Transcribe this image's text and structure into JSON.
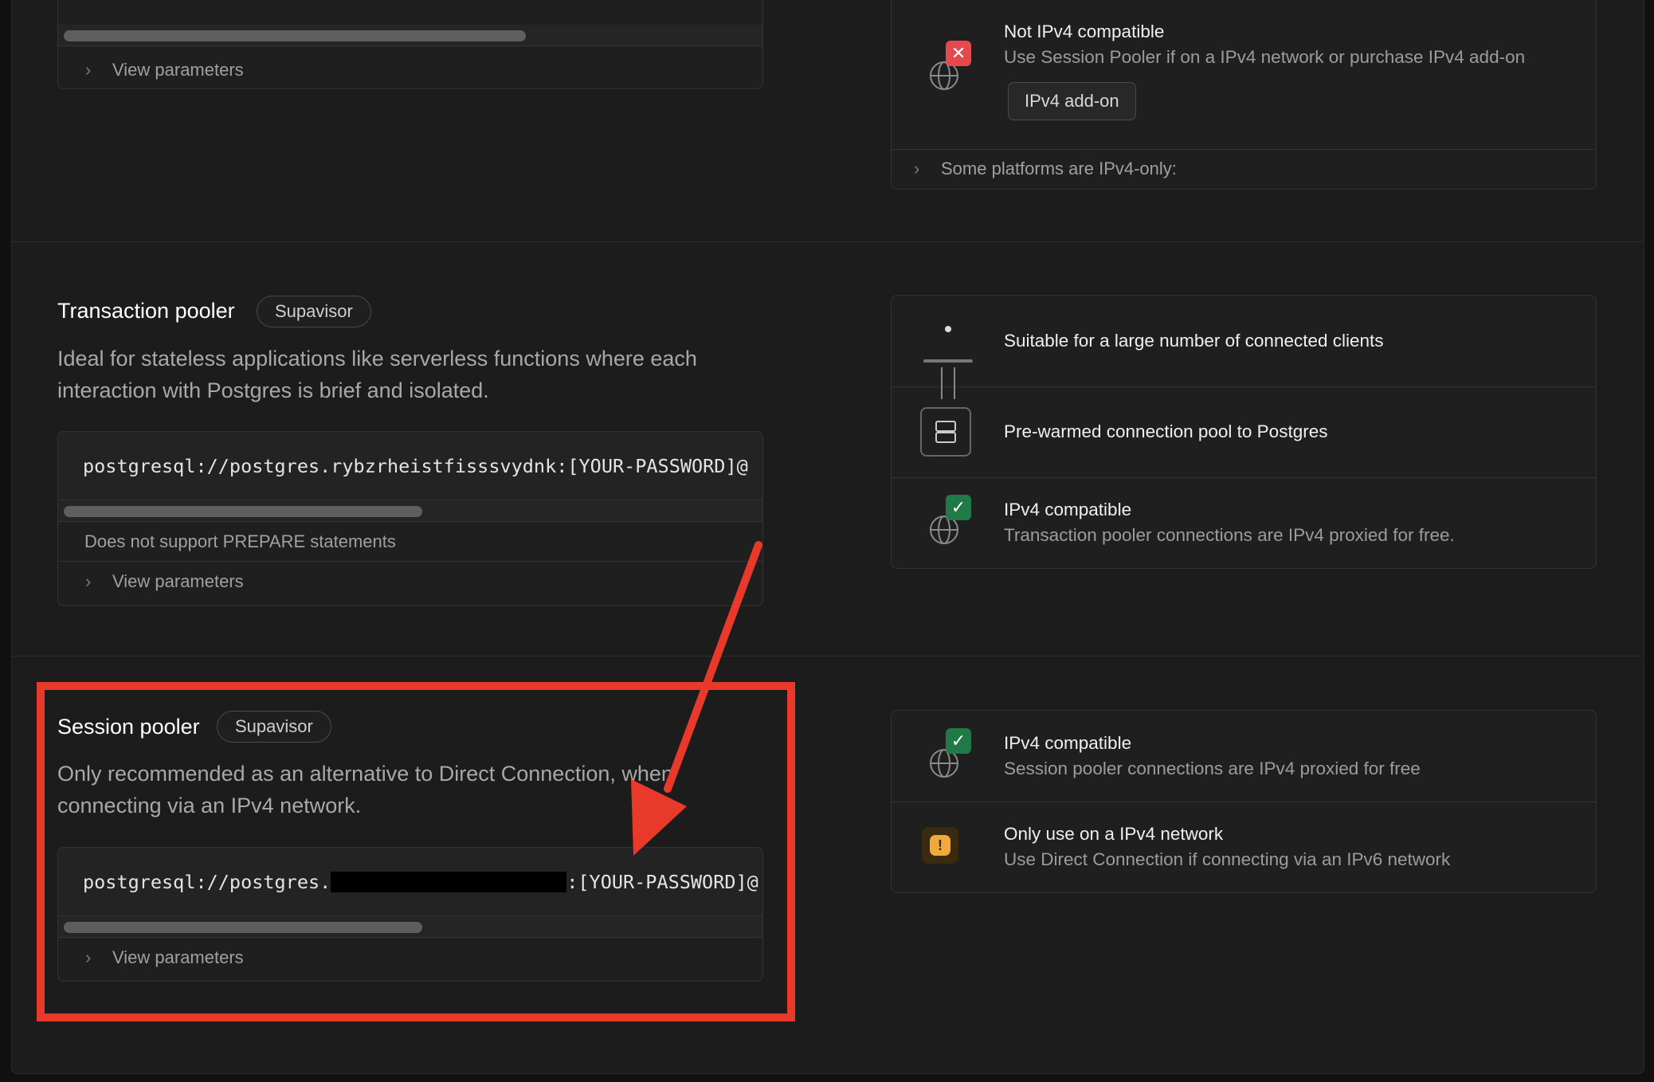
{
  "direct": {
    "view_params": "View parameters",
    "features": {
      "ipv4": {
        "title": "Not IPv4 compatible",
        "subtitle": "Use Session Pooler if on a IPv4 network or purchase IPv4 add-on",
        "button": "IPv4 add-on"
      },
      "platforms": "Some platforms are IPv4-only:"
    }
  },
  "transaction": {
    "title": "Transaction pooler",
    "badge": "Supavisor",
    "description_line1": "Ideal for stateless applications like serverless functions where each",
    "description_line2": "interaction with Postgres is brief and isolated.",
    "connection_string": "postgresql://postgres.rybzrheistfisssvydnk:[YOUR-PASSWORD]@",
    "note": "Does not support PREPARE statements",
    "view_params": "View parameters",
    "features": [
      {
        "title": "Suitable for a large number of connected clients"
      },
      {
        "title": "Pre-warmed connection pool to Postgres"
      },
      {
        "title": "IPv4 compatible",
        "subtitle": "Transaction pooler connections are IPv4 proxied for free."
      }
    ]
  },
  "session": {
    "title": "Session pooler",
    "badge": "Supavisor",
    "description_line1": "Only recommended as an alternative to Direct Connection, when",
    "description_line2": "connecting via an IPv4 network.",
    "connection_prefix": "postgresql://postgres.",
    "connection_suffix": ":[YOUR-PASSWORD]@",
    "view_params": "View parameters",
    "features": [
      {
        "title": "IPv4 compatible",
        "subtitle": "Session pooler connections are IPv4 proxied for free"
      },
      {
        "title": "Only use on a IPv4 network",
        "subtitle": "Use Direct Connection if connecting via an IPv6 network"
      }
    ]
  },
  "colors": {
    "annotation_red": "#e8392a",
    "success_green": "#1f7a45",
    "error_red": "#e5484d",
    "warning_amber": "#f0a93a"
  },
  "icons": [
    "chevron-right-icon",
    "globe-icon",
    "x-badge-icon",
    "check-badge-icon",
    "pooler-diagram-icon",
    "database-icon",
    "warning-icon"
  ]
}
